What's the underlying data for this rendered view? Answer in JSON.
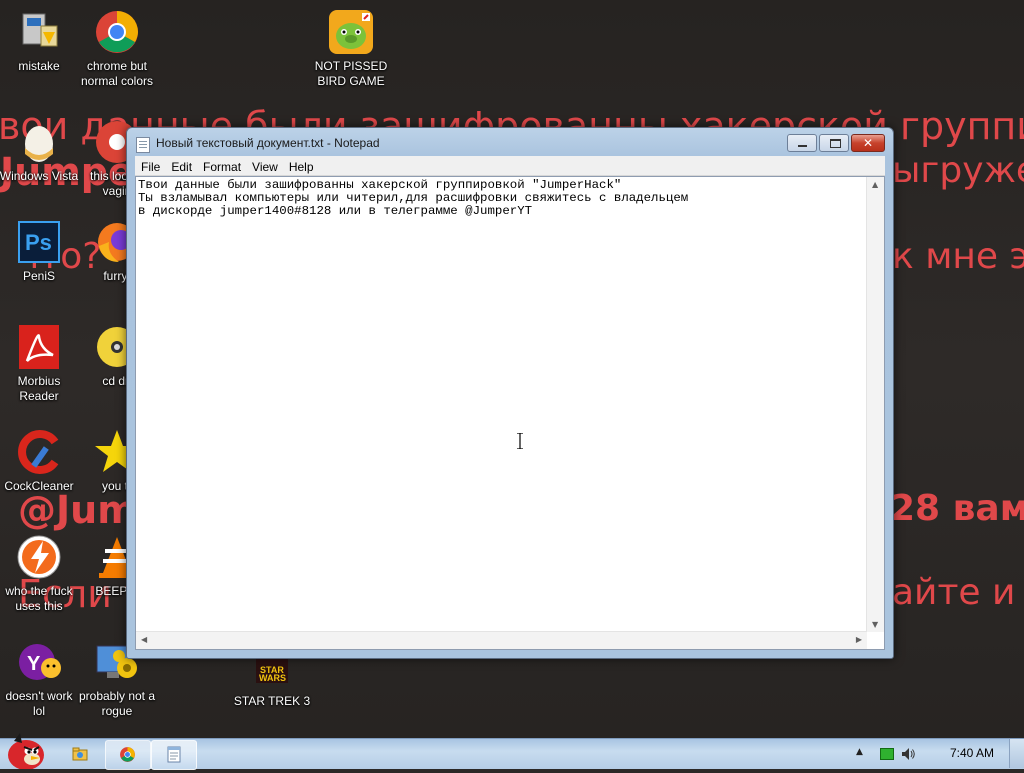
{
  "wallpaper": {
    "lines": [
      "вои данные были зашифрованны хакерской группировко",
      "Jumpe",
      "ыгруже",
      "что?",
      "к мне э",
      "@Jum",
      "28 вам",
      "Если у",
      "айте и"
    ]
  },
  "desktop_icons": [
    {
      "label": "mistake",
      "icon": "computer-icon"
    },
    {
      "label": "chrome but normal colors",
      "icon": "chrome-icon"
    },
    {
      "label": "NOT PISSED BIRD GAME",
      "icon": "pig-icon"
    },
    {
      "label": "Windows Vista",
      "icon": "egg-icon"
    },
    {
      "label": "this look a vagin",
      "icon": "chrome-icon"
    },
    {
      "label": "PeniS",
      "icon": "photoshop-icon"
    },
    {
      "label": "furryf",
      "icon": "firefox-icon"
    },
    {
      "label": "Morbius Reader",
      "icon": "acrobat-icon"
    },
    {
      "label": "cd dri",
      "icon": "cd-icon"
    },
    {
      "label": "CockCleaner",
      "icon": "ccleaner-icon"
    },
    {
      "label": "you tr",
      "icon": "star-icon"
    },
    {
      "label": "who the fuck uses this",
      "icon": "avast-icon"
    },
    {
      "label": "BEEP B",
      "icon": "vlc-icon"
    },
    {
      "label": "doesn't work lol",
      "icon": "yahoo-icon"
    },
    {
      "label": "probably not a rogue",
      "icon": "settings-icon"
    },
    {
      "label": "STAR TREK 3",
      "icon": "star-wars-icon"
    }
  ],
  "notepad": {
    "title": "Новый текстовый документ.txt - Notepad",
    "menu": [
      "File",
      "Edit",
      "Format",
      "View",
      "Help"
    ],
    "text": "Твои данные были зашифрованны хакерской группировкой \"JumperHack\"\nТы взламывал компьютеры или читерил,для расшифровки свяжитесь с владельцем\nв дискорде jumper1400#8128 или в телеграмме @JumperYT",
    "close_glyph": "✕"
  },
  "taskbar": {
    "clock": "7:40 AM",
    "pinned": [
      "explorer-icon",
      "chrome-icon",
      "notepad-icon"
    ]
  },
  "colors": {
    "wallpaper_text": "#e0484a",
    "taskbar": "#b6cde6"
  }
}
